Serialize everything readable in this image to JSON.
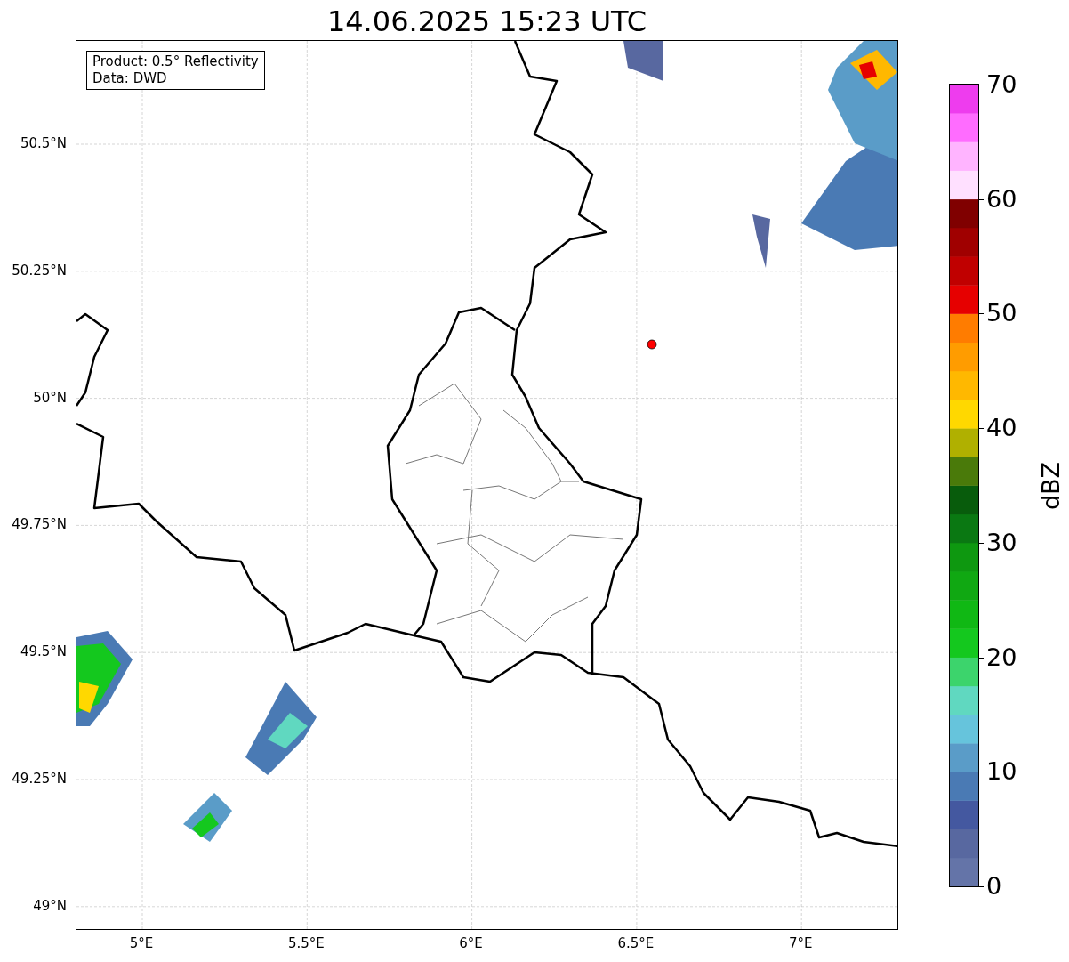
{
  "title": "14.06.2025 15:23 UTC",
  "info_box": [
    "Product: 0.5° Reflectivity",
    "Data: DWD"
  ],
  "y_ticks": [
    "50.5°N",
    "50.25°N",
    "50°N",
    "49.75°N",
    "49.5°N",
    "49.25°N",
    "49°N"
  ],
  "x_ticks": [
    "5°E",
    "5.5°E",
    "6°E",
    "6.5°E",
    "7°E"
  ],
  "colorbar": {
    "label": "dBZ",
    "ticks": [
      "70",
      "60",
      "50",
      "40",
      "30",
      "20",
      "10",
      "0"
    ]
  }
}
